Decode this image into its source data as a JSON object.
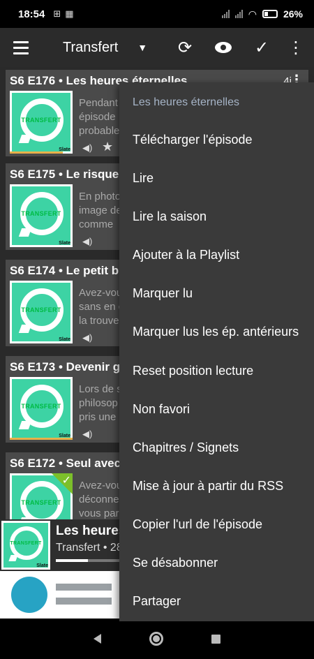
{
  "status_bar": {
    "time": "18:54",
    "icon_a": "⊞",
    "icon_b": "▦",
    "battery": "26%"
  },
  "toolbar": {
    "title": "Transfert",
    "icons": [
      "menu-icon",
      "caret-down-icon",
      "refresh-icon",
      "eye-icon",
      "check-icon",
      "more-vert-icon"
    ]
  },
  "episodes": [
    {
      "title": "S6 E176 • Les heures éternelles",
      "count": "4i",
      "desc": [
        "Pendant",
        "épisode",
        "probable"
      ],
      "has_star": true,
      "played": false,
      "progress": 0.85
    },
    {
      "title": "S6 E175 • Le risque",
      "desc": [
        "En photo",
        "image de",
        "comme"
      ],
      "has_star": false,
      "played": false,
      "progress": 0
    },
    {
      "title": "S6 E174 • Le petit bij",
      "desc": [
        "Avez-vou",
        "sans en c",
        "la trouve"
      ],
      "has_star": false,
      "played": false,
      "progress": 0
    },
    {
      "title": "S6 E173 • Devenir g",
      "desc": [
        "Lors de s",
        "philosop",
        "pris une"
      ],
      "has_star": false,
      "played": false,
      "progress": 1.0
    },
    {
      "title": "S6 E172 • Seul avec",
      "desc": [
        "Avez-vou",
        "déconne",
        "vous par"
      ],
      "has_star": false,
      "played": true,
      "progress": 0
    }
  ],
  "thumb": {
    "label": "TRANSFERT",
    "brand": "Slate"
  },
  "player": {
    "title": "Les heures",
    "subtitle": "Transfert • 28",
    "progress": 0.5
  },
  "menu": {
    "header": "Les heures éternelles",
    "items": [
      "Télécharger l'épisode",
      "Lire",
      "Lire la saison",
      "Ajouter à la Playlist",
      "Marquer lu",
      "Marquer lus les ép. antérieurs",
      "Reset position lecture",
      "Non favori",
      "Chapitres / Signets",
      "Mise à jour à partir du RSS",
      "Copier l'url de l'épisode",
      "Se désabonner",
      "Partager"
    ]
  },
  "colors": {
    "accent_green": "#3dd3a4",
    "progress_orange": "#e8b14a",
    "menu_bg": "#3a3a3a",
    "menu_header": "#a6b4c7"
  }
}
